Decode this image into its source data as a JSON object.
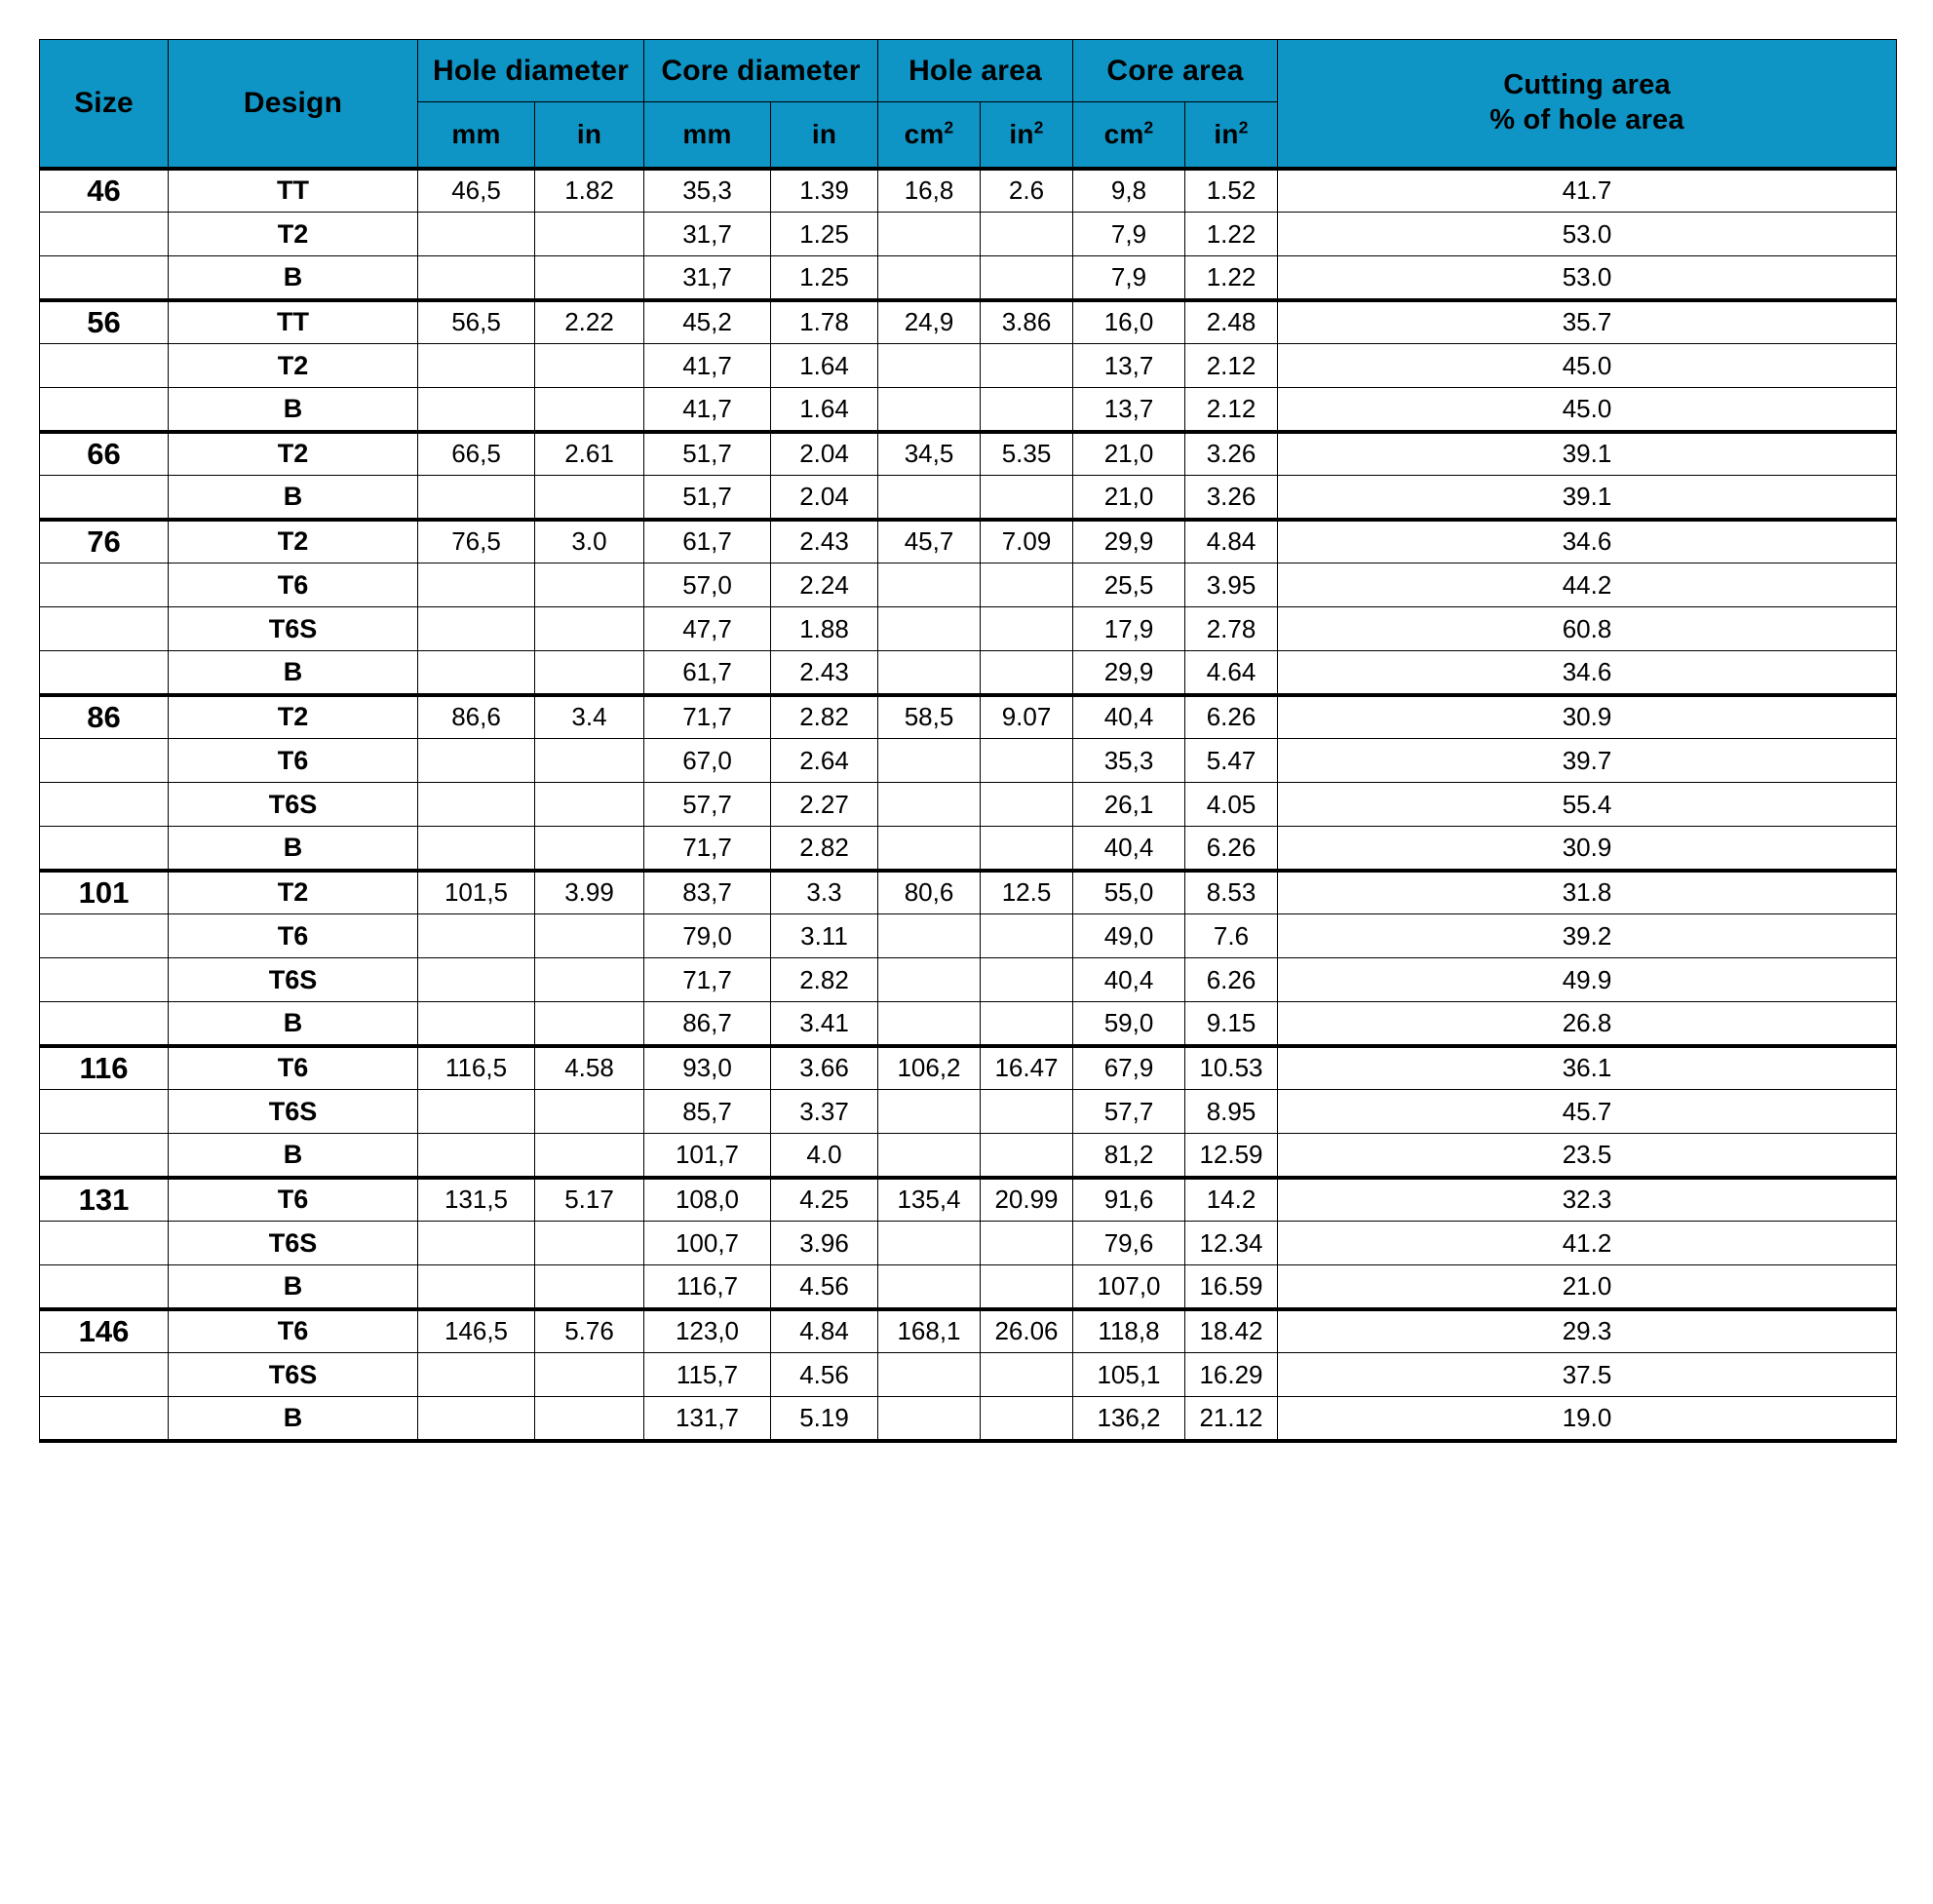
{
  "table": {
    "header": {
      "size": "Size",
      "design": "Design",
      "hole_diameter": "Hole diameter",
      "core_diameter": "Core diameter",
      "hole_area": "Hole area",
      "core_area": "Core area",
      "cutting_area_line1": "Cutting area",
      "cutting_area_line2": "% of hole area",
      "units": {
        "mm": "mm",
        "in": "in",
        "cm2_base": "cm",
        "cm2_sup": "2",
        "in2_base": "in",
        "in2_sup": "2"
      }
    },
    "columns": [
      "Size",
      "Design",
      "Hole diameter mm",
      "Hole diameter in",
      "Core diameter mm",
      "Core diameter in",
      "Hole area cm2",
      "Hole area in2",
      "Core area cm2",
      "Core area in2",
      "Cutting area % of hole area"
    ],
    "rows": [
      {
        "group_start": true,
        "size": "46",
        "design": "TT",
        "hole_mm": "46,5",
        "hole_in": "1.82",
        "core_mm": "35,3",
        "core_in": "1.39",
        "hole_cm2": "16,8",
        "hole_in2": "2.6",
        "core_cm2": "9,8",
        "core_in2": "1.52",
        "cutting": "41.7"
      },
      {
        "group_start": false,
        "size": "",
        "design": "T2",
        "hole_mm": "",
        "hole_in": "",
        "core_mm": "31,7",
        "core_in": "1.25",
        "hole_cm2": "",
        "hole_in2": "",
        "core_cm2": "7,9",
        "core_in2": "1.22",
        "cutting": "53.0"
      },
      {
        "group_start": false,
        "size": "",
        "design": "B",
        "hole_mm": "",
        "hole_in": "",
        "core_mm": "31,7",
        "core_in": "1.25",
        "hole_cm2": "",
        "hole_in2": "",
        "core_cm2": "7,9",
        "core_in2": "1.22",
        "cutting": "53.0"
      },
      {
        "group_start": true,
        "size": "56",
        "design": "TT",
        "hole_mm": "56,5",
        "hole_in": "2.22",
        "core_mm": "45,2",
        "core_in": "1.78",
        "hole_cm2": "24,9",
        "hole_in2": "3.86",
        "core_cm2": "16,0",
        "core_in2": "2.48",
        "cutting": "35.7"
      },
      {
        "group_start": false,
        "size": "",
        "design": "T2",
        "hole_mm": "",
        "hole_in": "",
        "core_mm": "41,7",
        "core_in": "1.64",
        "hole_cm2": "",
        "hole_in2": "",
        "core_cm2": "13,7",
        "core_in2": "2.12",
        "cutting": "45.0"
      },
      {
        "group_start": false,
        "size": "",
        "design": "B",
        "hole_mm": "",
        "hole_in": "",
        "core_mm": "41,7",
        "core_in": "1.64",
        "hole_cm2": "",
        "hole_in2": "",
        "core_cm2": "13,7",
        "core_in2": "2.12",
        "cutting": "45.0"
      },
      {
        "group_start": true,
        "size": "66",
        "design": "T2",
        "hole_mm": "66,5",
        "hole_in": "2.61",
        "core_mm": "51,7",
        "core_in": "2.04",
        "hole_cm2": "34,5",
        "hole_in2": "5.35",
        "core_cm2": "21,0",
        "core_in2": "3.26",
        "cutting": "39.1"
      },
      {
        "group_start": false,
        "size": "",
        "design": "B",
        "hole_mm": "",
        "hole_in": "",
        "core_mm": "51,7",
        "core_in": "2.04",
        "hole_cm2": "",
        "hole_in2": "",
        "core_cm2": "21,0",
        "core_in2": "3.26",
        "cutting": "39.1"
      },
      {
        "group_start": true,
        "size": "76",
        "design": "T2",
        "hole_mm": "76,5",
        "hole_in": "3.0",
        "core_mm": "61,7",
        "core_in": "2.43",
        "hole_cm2": "45,7",
        "hole_in2": "7.09",
        "core_cm2": "29,9",
        "core_in2": "4.84",
        "cutting": "34.6"
      },
      {
        "group_start": false,
        "size": "",
        "design": "T6",
        "hole_mm": "",
        "hole_in": "",
        "core_mm": "57,0",
        "core_in": "2.24",
        "hole_cm2": "",
        "hole_in2": "",
        "core_cm2": "25,5",
        "core_in2": "3.95",
        "cutting": "44.2"
      },
      {
        "group_start": false,
        "size": "",
        "design": "T6S",
        "hole_mm": "",
        "hole_in": "",
        "core_mm": "47,7",
        "core_in": "1.88",
        "hole_cm2": "",
        "hole_in2": "",
        "core_cm2": "17,9",
        "core_in2": "2.78",
        "cutting": "60.8"
      },
      {
        "group_start": false,
        "size": "",
        "design": "B",
        "hole_mm": "",
        "hole_in": "",
        "core_mm": "61,7",
        "core_in": "2.43",
        "hole_cm2": "",
        "hole_in2": "",
        "core_cm2": "29,9",
        "core_in2": "4.64",
        "cutting": "34.6"
      },
      {
        "group_start": true,
        "size": "86",
        "design": "T2",
        "hole_mm": "86,6",
        "hole_in": "3.4",
        "core_mm": "71,7",
        "core_in": "2.82",
        "hole_cm2": "58,5",
        "hole_in2": "9.07",
        "core_cm2": "40,4",
        "core_in2": "6.26",
        "cutting": "30.9"
      },
      {
        "group_start": false,
        "size": "",
        "design": "T6",
        "hole_mm": "",
        "hole_in": "",
        "core_mm": "67,0",
        "core_in": "2.64",
        "hole_cm2": "",
        "hole_in2": "",
        "core_cm2": "35,3",
        "core_in2": "5.47",
        "cutting": "39.7"
      },
      {
        "group_start": false,
        "size": "",
        "design": "T6S",
        "hole_mm": "",
        "hole_in": "",
        "core_mm": "57,7",
        "core_in": "2.27",
        "hole_cm2": "",
        "hole_in2": "",
        "core_cm2": "26,1",
        "core_in2": "4.05",
        "cutting": "55.4"
      },
      {
        "group_start": false,
        "size": "",
        "design": "B",
        "hole_mm": "",
        "hole_in": "",
        "core_mm": "71,7",
        "core_in": "2.82",
        "hole_cm2": "",
        "hole_in2": "",
        "core_cm2": "40,4",
        "core_in2": "6.26",
        "cutting": "30.9"
      },
      {
        "group_start": true,
        "size": "101",
        "design": "T2",
        "hole_mm": "101,5",
        "hole_in": "3.99",
        "core_mm": "83,7",
        "core_in": "3.3",
        "hole_cm2": "80,6",
        "hole_in2": "12.5",
        "core_cm2": "55,0",
        "core_in2": "8.53",
        "cutting": "31.8"
      },
      {
        "group_start": false,
        "size": "",
        "design": "T6",
        "hole_mm": "",
        "hole_in": "",
        "core_mm": "79,0",
        "core_in": "3.11",
        "hole_cm2": "",
        "hole_in2": "",
        "core_cm2": "49,0",
        "core_in2": "7.6",
        "cutting": "39.2"
      },
      {
        "group_start": false,
        "size": "",
        "design": "T6S",
        "hole_mm": "",
        "hole_in": "",
        "core_mm": "71,7",
        "core_in": "2.82",
        "hole_cm2": "",
        "hole_in2": "",
        "core_cm2": "40,4",
        "core_in2": "6.26",
        "cutting": "49.9"
      },
      {
        "group_start": false,
        "size": "",
        "design": "B",
        "hole_mm": "",
        "hole_in": "",
        "core_mm": "86,7",
        "core_in": "3.41",
        "hole_cm2": "",
        "hole_in2": "",
        "core_cm2": "59,0",
        "core_in2": "9.15",
        "cutting": "26.8"
      },
      {
        "group_start": true,
        "size": "116",
        "design": "T6",
        "hole_mm": "116,5",
        "hole_in": "4.58",
        "core_mm": "93,0",
        "core_in": "3.66",
        "hole_cm2": "106,2",
        "hole_in2": "16.47",
        "core_cm2": "67,9",
        "core_in2": "10.53",
        "cutting": "36.1"
      },
      {
        "group_start": false,
        "size": "",
        "design": "T6S",
        "hole_mm": "",
        "hole_in": "",
        "core_mm": "85,7",
        "core_in": "3.37",
        "hole_cm2": "",
        "hole_in2": "",
        "core_cm2": "57,7",
        "core_in2": "8.95",
        "cutting": "45.7"
      },
      {
        "group_start": false,
        "size": "",
        "design": "B",
        "hole_mm": "",
        "hole_in": "",
        "core_mm": "101,7",
        "core_in": "4.0",
        "hole_cm2": "",
        "hole_in2": "",
        "core_cm2": "81,2",
        "core_in2": "12.59",
        "cutting": "23.5"
      },
      {
        "group_start": true,
        "size": "131",
        "design": "T6",
        "hole_mm": "131,5",
        "hole_in": "5.17",
        "core_mm": "108,0",
        "core_in": "4.25",
        "hole_cm2": "135,4",
        "hole_in2": "20.99",
        "core_cm2": "91,6",
        "core_in2": "14.2",
        "cutting": "32.3"
      },
      {
        "group_start": false,
        "size": "",
        "design": "T6S",
        "hole_mm": "",
        "hole_in": "",
        "core_mm": "100,7",
        "core_in": "3.96",
        "hole_cm2": "",
        "hole_in2": "",
        "core_cm2": "79,6",
        "core_in2": "12.34",
        "cutting": "41.2"
      },
      {
        "group_start": false,
        "size": "",
        "design": "B",
        "hole_mm": "",
        "hole_in": "",
        "core_mm": "116,7",
        "core_in": "4.56",
        "hole_cm2": "",
        "hole_in2": "",
        "core_cm2": "107,0",
        "core_in2": "16.59",
        "cutting": "21.0"
      },
      {
        "group_start": true,
        "size": "146",
        "design": "T6",
        "hole_mm": "146,5",
        "hole_in": "5.76",
        "core_mm": "123,0",
        "core_in": "4.84",
        "hole_cm2": "168,1",
        "hole_in2": "26.06",
        "core_cm2": "118,8",
        "core_in2": "18.42",
        "cutting": "29.3"
      },
      {
        "group_start": false,
        "size": "",
        "design": "T6S",
        "hole_mm": "",
        "hole_in": "",
        "core_mm": "115,7",
        "core_in": "4.56",
        "hole_cm2": "",
        "hole_in2": "",
        "core_cm2": "105,1",
        "core_in2": "16.29",
        "cutting": "37.5"
      },
      {
        "group_start": false,
        "size": "",
        "design": "B",
        "hole_mm": "",
        "hole_in": "",
        "core_mm": "131,7",
        "core_in": "5.19",
        "hole_cm2": "",
        "hole_in2": "",
        "core_cm2": "136,2",
        "core_in2": "21.12",
        "cutting": "19.0"
      }
    ]
  },
  "colors": {
    "header_blue": "#0f95c5",
    "header_text": "#ffffff",
    "grid_line": "#231f20",
    "page_background": "#ffffff"
  }
}
